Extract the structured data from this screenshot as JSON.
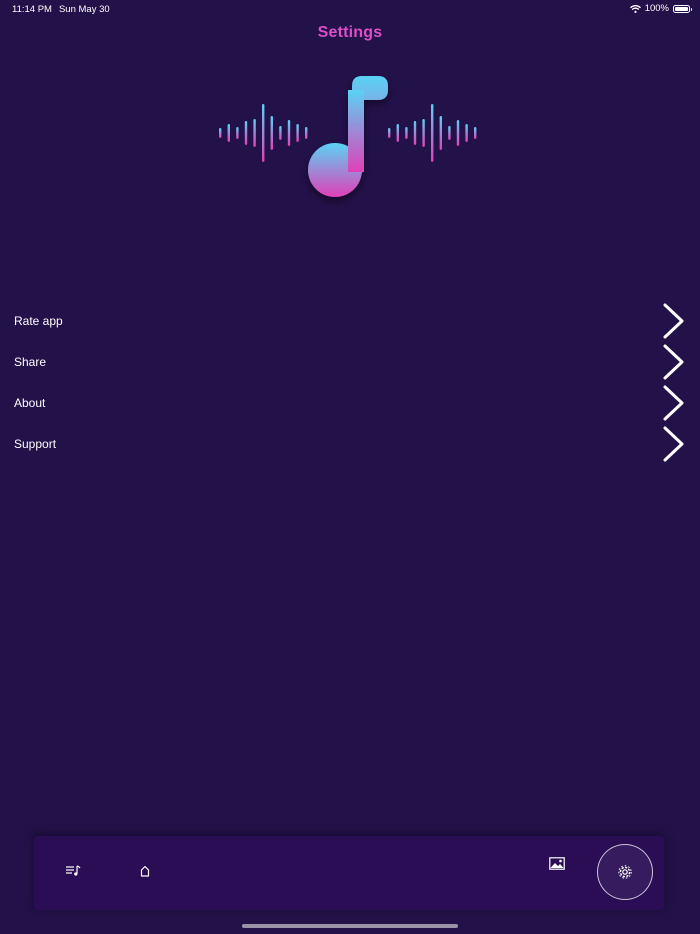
{
  "status_bar": {
    "time": "11:14 PM",
    "date": "Sun May 30",
    "battery": "100%",
    "battery_level": 1.0
  },
  "header": {
    "title": "Settings"
  },
  "logo": {
    "icon": "music-note-waveform-logo",
    "gradient_top": "#5ad2f4",
    "gradient_bottom": "#e040b8"
  },
  "menu": {
    "items": [
      {
        "label": "Rate app",
        "icon": "chevron-right-icon"
      },
      {
        "label": "Share",
        "icon": "chevron-right-icon"
      },
      {
        "label": "About",
        "icon": "chevron-right-icon"
      },
      {
        "label": "Support",
        "icon": "chevron-right-icon"
      }
    ]
  },
  "tab_bar": {
    "tabs": [
      {
        "name": "playlist",
        "icon": "playlist-icon"
      },
      {
        "name": "home",
        "icon": "home-icon"
      },
      {
        "name": "gallery",
        "icon": "image-icon"
      },
      {
        "name": "settings",
        "icon": "gear-icon",
        "selected": true
      }
    ]
  },
  "colors": {
    "background": "#231149",
    "title": "#dc4fc6",
    "tab_bar": "#2a0d54",
    "text": "#ffffff"
  }
}
